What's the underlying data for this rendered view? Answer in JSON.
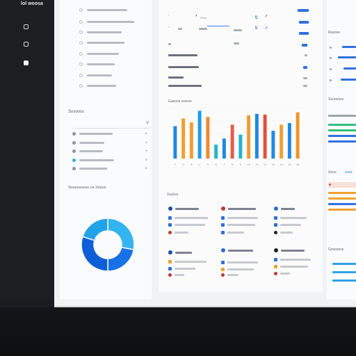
{
  "app": {
    "brand": "lol woosa"
  },
  "left_rail": {
    "icons": [
      "document-icon",
      "file-icon",
      "clipboard-icon"
    ]
  },
  "nav": {
    "items": [
      {
        "label": ""
      },
      {
        "label": ""
      },
      {
        "label": ""
      },
      {
        "label": ""
      },
      {
        "label": ""
      },
      {
        "label": ""
      },
      {
        "label": ""
      },
      {
        "label": ""
      }
    ]
  },
  "section_a": {
    "title": "Susooss",
    "select_chevron": "v",
    "list": [
      {
        "label": "",
        "arrow": "▸"
      },
      {
        "label": "",
        "arrow": "▸"
      },
      {
        "label": "",
        "arrow": "▸"
      },
      {
        "label": "",
        "arrow": "▸"
      },
      {
        "label": "",
        "arrow": "▸"
      }
    ]
  },
  "section_b": {
    "title": "Sosoosooso os Sosos"
  },
  "donut": {
    "segments": [
      {
        "value": 28,
        "color": "#34b4ee"
      },
      {
        "value": 22,
        "color": "#1672e6"
      },
      {
        "value": 30,
        "color": "#0d5fd8"
      },
      {
        "value": 20,
        "color": "#22a2ea"
      }
    ]
  },
  "center": {
    "table_label": "Sose",
    "chart_title": "Gaeoss ssoroe",
    "cards_title": "Sadsss"
  },
  "chart_data": {
    "type": "bar",
    "categories": [
      "1",
      "2",
      "3",
      "4",
      "5",
      "6",
      "7",
      "8",
      "9",
      "10",
      "11",
      "12",
      "13",
      "14",
      "15",
      "16"
    ],
    "series": [
      {
        "values": [
          42,
          52,
          0,
          30,
          0,
          18,
          36,
          0,
          0,
          0,
          35,
          0,
          0,
          26,
          0,
          30
        ]
      },
      {
        "values": [
          0,
          0,
          47,
          0,
          20,
          0,
          0,
          45,
          30,
          58,
          0,
          0,
          58,
          0,
          60,
          0
        ]
      },
      {
        "values": [
          0,
          0,
          0,
          0,
          0,
          0,
          0,
          0,
          0,
          0,
          0,
          0,
          0,
          0,
          0,
          0
        ]
      }
    ],
    "bars": [
      {
        "value": 42,
        "color": "#1e88e5"
      },
      {
        "value": 52,
        "color": "#f0a030"
      },
      {
        "value": 47,
        "color": "#f0a030"
      },
      {
        "value": 62,
        "color": "#1e9be6"
      },
      {
        "value": 54,
        "color": "#f08a2a"
      },
      {
        "value": 18,
        "color": "#22b5c9"
      },
      {
        "value": 26,
        "color": "#1e88e5"
      },
      {
        "value": 44,
        "color": "#e85a4a"
      },
      {
        "value": 31,
        "color": "#22b5c9"
      },
      {
        "value": 56,
        "color": "#f09a30"
      },
      {
        "value": 58,
        "color": "#1e88e5"
      },
      {
        "value": 57,
        "color": "#e74c3c"
      },
      {
        "value": 36,
        "color": "#1e88e5"
      },
      {
        "value": 44,
        "color": "#f0a030"
      },
      {
        "value": 46,
        "color": "#1e88e5"
      },
      {
        "value": 60,
        "color": "#f0952a"
      }
    ],
    "ylim": [
      0,
      65
    ]
  },
  "cards": [
    {
      "icon_color": "#1d4fa8"
    },
    {
      "icon_color": "#c0392b"
    },
    {
      "icon_color": "#2a6fd9"
    },
    {
      "icon_color": "#1d4fa8"
    },
    {
      "icon_color": "#2a6fd9"
    },
    {
      "icon_color": "#222222"
    }
  ],
  "right_panel": {
    "titles": [
      "Rusoss",
      "Souoooss",
      "Souo",
      "Gosososs"
    ],
    "tag": "sosa"
  }
}
